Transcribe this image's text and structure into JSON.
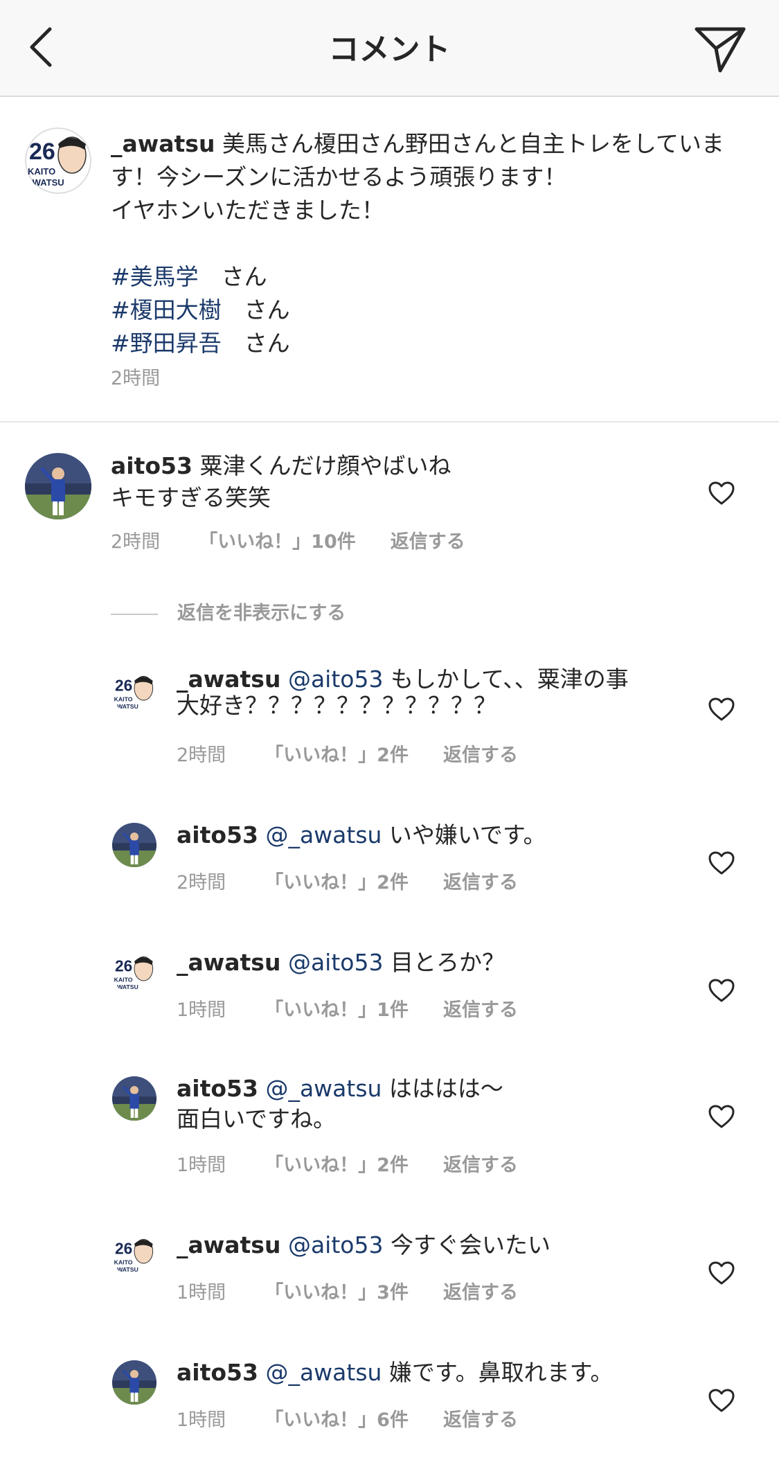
{
  "header": {
    "title": "コメント"
  },
  "post": {
    "username": "_awatsu",
    "caption_line1": " 美馬さん榎田さん野田さんと自主トレをしていま",
    "caption_line2": "す！今シーズンに活かせるよう頑張ります！",
    "caption_line3": "イヤホンいただきました！",
    "tags": [
      {
        "tag": "#美馬学",
        "suffix": "　さん"
      },
      {
        "tag": "#榎田大樹",
        "suffix": "　さん"
      },
      {
        "tag": "#野田昇吾",
        "suffix": "　さん"
      }
    ],
    "time": "2時間",
    "avatar_text": {
      "number": "26",
      "line1": "KAITO",
      "line2": "AWATSU"
    }
  },
  "comment": {
    "username": "aito53",
    "line1": " 粟津くんだけ顔やばいね",
    "line2": "キモすぎる笑笑",
    "time": "2時間",
    "likes": "「いいね！」10件",
    "reply": "返信する"
  },
  "hide_replies_label": "返信を非表示にする",
  "replies": [
    {
      "username": "_awatsu",
      "mention": "@aito53",
      "text": " もしかして、、粟津の事",
      "text2": "大好き？？？？？？？？？？？",
      "time": "2時間",
      "likes": "「いいね！」2件",
      "reply": "返信する"
    },
    {
      "username": "aito53",
      "mention": "@_awatsu",
      "text": " いや嫌いです。",
      "text2": "",
      "time": "2時間",
      "likes": "「いいね！」2件",
      "reply": "返信する"
    },
    {
      "username": "_awatsu",
      "mention": "@aito53",
      "text": " 目とろか？",
      "text2": "",
      "time": "1時間",
      "likes": "「いいね！」1件",
      "reply": "返信する"
    },
    {
      "username": "aito53",
      "mention": "@_awatsu",
      "text": " はははは〜",
      "text2": "面白いですね。",
      "time": "1時間",
      "likes": "「いいね！」2件",
      "reply": "返信する"
    },
    {
      "username": "_awatsu",
      "mention": "@aito53",
      "text": " 今すぐ会いたい",
      "text2": "",
      "time": "1時間",
      "likes": "「いいね！」3件",
      "reply": "返信する"
    },
    {
      "username": "aito53",
      "mention": "@_awatsu",
      "text": " 嫌です。鼻取れます。",
      "text2": "",
      "time": "1時間",
      "likes": "「いいね！」6件",
      "reply": "返信する"
    }
  ],
  "colors": {
    "link": "#1b3a6b",
    "muted": "#999999",
    "text": "#262626",
    "header_bg": "#f8f8f8"
  },
  "icons": {
    "back": "chevron-left-icon",
    "share": "paper-plane-icon",
    "like": "heart-outline-icon"
  }
}
